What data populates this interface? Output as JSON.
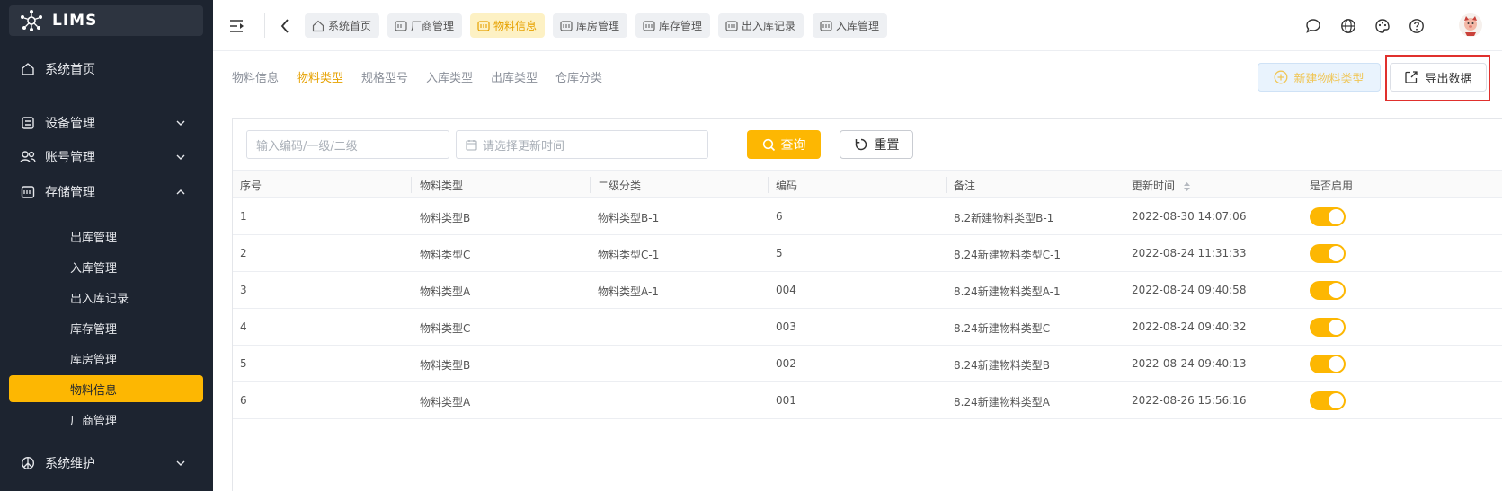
{
  "app": {
    "name": "LIMS"
  },
  "sidebar": {
    "items": [
      {
        "label": "系统首页",
        "icon": "home-icon"
      },
      {
        "label": "设备管理",
        "icon": "device-icon",
        "expandable": true
      },
      {
        "label": "账号管理",
        "icon": "users-icon",
        "expandable": true
      },
      {
        "label": "存储管理",
        "icon": "storage-icon",
        "expanded": true
      },
      {
        "label": "系统维护",
        "icon": "maintenance-icon",
        "expandable": true
      }
    ],
    "storage_children": [
      "出库管理",
      "入库管理",
      "出入库记录",
      "库存管理",
      "库房管理",
      "物料信息",
      "厂商管理"
    ],
    "active_child": "物料信息",
    "colors": {
      "bg": "#1d2430",
      "active": "#fdb702"
    }
  },
  "topbar": {
    "tags": [
      {
        "label": "系统首页",
        "icon": "home-icon"
      },
      {
        "label": "厂商管理",
        "icon": "tab-icon"
      },
      {
        "label": "物料信息",
        "icon": "tab-icon",
        "active": true
      },
      {
        "label": "库房管理",
        "icon": "tab-icon"
      },
      {
        "label": "库存管理",
        "icon": "tab-icon"
      },
      {
        "label": "出入库记录",
        "icon": "tab-icon"
      },
      {
        "label": "入库管理",
        "icon": "tab-icon"
      }
    ],
    "right_icons": [
      "chat-icon",
      "globe-icon",
      "palette-icon",
      "help-icon",
      "avatar"
    ]
  },
  "subtabs": {
    "items": [
      "物料信息",
      "物料类型",
      "规格型号",
      "入库类型",
      "出库类型",
      "仓库分类"
    ],
    "active": "物料类型",
    "new_button": "新建物料类型",
    "export_button": "导出数据"
  },
  "filters": {
    "code_placeholder": "输入编码/一级/二级",
    "date_placeholder": "请选择更新时间",
    "query_button": "查询",
    "reset_button": "重置"
  },
  "table": {
    "columns": [
      "序号",
      "物料类型",
      "二级分类",
      "编码",
      "备注",
      "更新时间",
      "是否启用"
    ],
    "rows": [
      {
        "index": "1",
        "type": "物料类型B",
        "sub": "物料类型B-1",
        "code": "6",
        "remark": "8.2新建物料类型B-1",
        "updated": "2022-08-30 14:07:06",
        "enabled": true
      },
      {
        "index": "2",
        "type": "物料类型C",
        "sub": "物料类型C-1",
        "code": "5",
        "remark": "8.24新建物料类型C-1",
        "updated": "2022-08-24 11:31:33",
        "enabled": true
      },
      {
        "index": "3",
        "type": "物料类型A",
        "sub": "物料类型A-1",
        "code": "004",
        "remark": "8.24新建物料类型A-1",
        "updated": "2022-08-24 09:40:58",
        "enabled": true
      },
      {
        "index": "4",
        "type": "物料类型C",
        "sub": "",
        "code": "003",
        "remark": "8.24新建物料类型C",
        "updated": "2022-08-24 09:40:32",
        "enabled": true
      },
      {
        "index": "5",
        "type": "物料类型B",
        "sub": "",
        "code": "002",
        "remark": "8.24新建物料类型B",
        "updated": "2022-08-24 09:40:13",
        "enabled": true
      },
      {
        "index": "6",
        "type": "物料类型A",
        "sub": "",
        "code": "001",
        "remark": "8.24新建物料类型A",
        "updated": "2022-08-26 15:56:16",
        "enabled": true
      }
    ]
  }
}
